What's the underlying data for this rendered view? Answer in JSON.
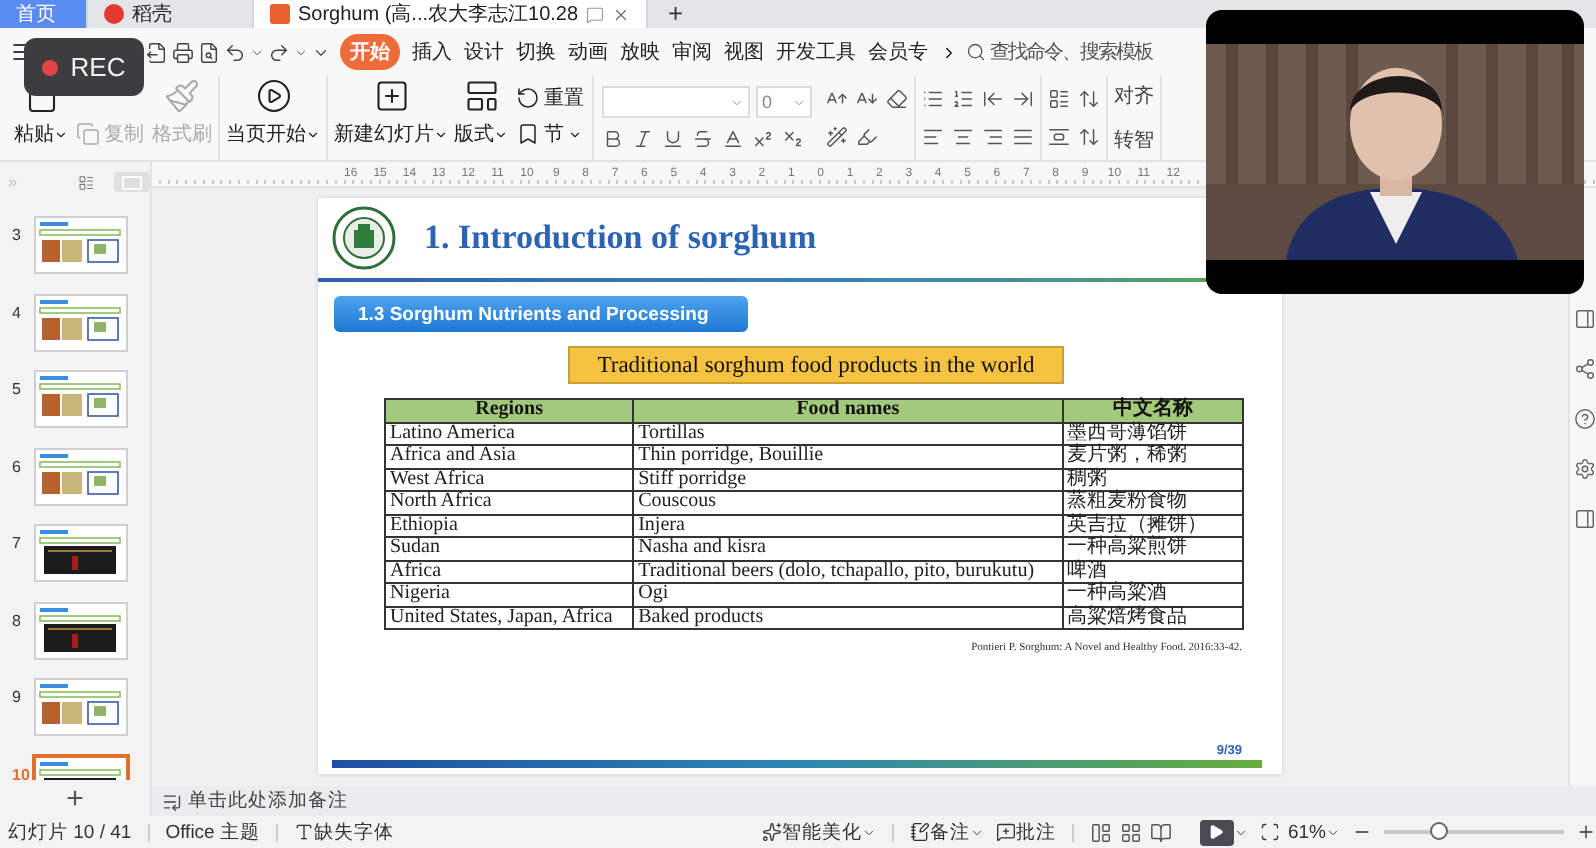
{
  "tabs": [
    {
      "label": "首页",
      "selected": false,
      "kind": "home"
    },
    {
      "label": "稻壳",
      "selected": false,
      "kind": "app"
    },
    {
      "label": "Sorghum (高...农大李志江10.28",
      "selected": true,
      "kind": "doc"
    }
  ],
  "new_tab": "+",
  "rec": "REC",
  "ribbon_tabs": [
    {
      "label": "开始",
      "selected": true
    },
    {
      "label": "插入",
      "selected": false
    },
    {
      "label": "设计",
      "selected": false
    },
    {
      "label": "切换",
      "selected": false
    },
    {
      "label": "动画",
      "selected": false
    },
    {
      "label": "放映",
      "selected": false
    },
    {
      "label": "审阅",
      "selected": false
    },
    {
      "label": "视图",
      "selected": false
    },
    {
      "label": "开发工具",
      "selected": false
    },
    {
      "label": "会员专",
      "selected": false
    }
  ],
  "search": {
    "placeholder": "查找命令、搜索模板"
  },
  "tool_groups": [
    [
      {
        "label": "粘贴",
        "kind": "large",
        "disabled": false,
        "dropdown": true
      },
      {
        "label": "复制",
        "kind": "small",
        "disabled": true,
        "dropdown": false
      },
      {
        "label": "格式刷",
        "kind": "large",
        "disabled": true,
        "dropdown": false
      }
    ],
    [
      {
        "label": "当页开始",
        "kind": "large",
        "disabled": false,
        "dropdown": true
      }
    ],
    [
      {
        "label": "新建幻灯片",
        "kind": "large",
        "disabled": false,
        "dropdown": true
      },
      {
        "label": "版式",
        "kind": "large",
        "disabled": false,
        "dropdown": true
      },
      {
        "label": "重置",
        "kind": "small",
        "disabled": false,
        "dropdown": false
      },
      {
        "label": "节",
        "kind": "small",
        "disabled": false,
        "dropdown": true
      }
    ]
  ],
  "font_size": "0",
  "tools_right": [
    {
      "label": "对齐"
    },
    {
      "label": "转智"
    }
  ],
  "ruler": [
    "16",
    "15",
    "14",
    "13",
    "12",
    "11",
    "10",
    "9",
    "8",
    "7",
    "6",
    "5",
    "4",
    "3",
    "2",
    "1",
    "0",
    "1",
    "2",
    "3",
    "4",
    "5",
    "6",
    "7",
    "8",
    "9",
    "10",
    "11",
    "12"
  ],
  "thumbnails": [
    {
      "number": "3",
      "selected": false,
      "kind": "light"
    },
    {
      "number": "4",
      "selected": false,
      "kind": "light"
    },
    {
      "number": "5",
      "selected": false,
      "kind": "light"
    },
    {
      "number": "6",
      "selected": false,
      "kind": "light"
    },
    {
      "number": "7",
      "selected": false,
      "kind": "dark"
    },
    {
      "number": "8",
      "selected": false,
      "kind": "dark"
    },
    {
      "number": "9",
      "selected": false,
      "kind": "light"
    },
    {
      "number": "10",
      "selected": true,
      "kind": "dark"
    }
  ],
  "add_slide": "+",
  "slide": {
    "title": "1. Introduction of sorghum",
    "section": "1.3 Sorghum Nutrients and Processing",
    "caption": "Traditional sorghum food products in the world",
    "table": {
      "columns": [
        "Regions",
        "Food names",
        "中文名称"
      ],
      "rows": [
        [
          "Latino America",
          "Tortillas",
          "墨西哥薄馅饼"
        ],
        [
          "Africa and Asia",
          "Thin porridge, Bouillie",
          "麦片粥，稀粥"
        ],
        [
          "West Africa",
          "Stiff porridge",
          "稠粥"
        ],
        [
          "North Africa",
          "Couscous",
          "蒸粗麦粉食物"
        ],
        [
          "Ethiopia",
          "Injera",
          "英吉拉（摊饼）"
        ],
        [
          "Sudan",
          "Nasha and kisra",
          "一种高粱煎饼"
        ],
        [
          "Africa",
          "Traditional beers (dolo, tchapallo, pito, burukutu)",
          "啤酒"
        ],
        [
          "Nigeria",
          "Ogi",
          "一种高粱酒"
        ],
        [
          "United States, Japan, Africa",
          "Baked products",
          "高粱焙烤食品"
        ]
      ]
    },
    "citation": "Pontieri P. Sorghum: A Novel and Healthy Food. 2016:33-42.",
    "page": "9/39"
  },
  "notes": {
    "placeholder": "单击此处添加备注"
  },
  "status": {
    "slide": "幻灯片 10 / 41",
    "theme": "Office 主题",
    "missing_fonts": "缺失字体",
    "beautify": "智能美化",
    "notes": "备注",
    "comments": "批注",
    "zoom": "61%"
  },
  "zoom_slider": {
    "level": 0.3
  },
  "video": {
    "kind": "picture"
  }
}
